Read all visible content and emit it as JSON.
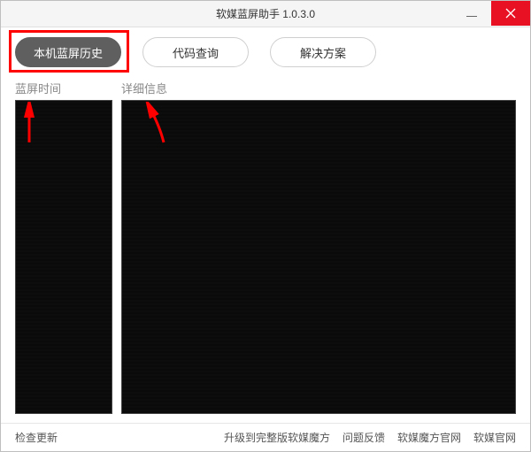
{
  "window": {
    "title": "软媒蓝屏助手 1.0.3.0"
  },
  "tabs": {
    "history": "本机蓝屏历史",
    "code_lookup": "代码查询",
    "solution": "解决方案"
  },
  "headers": {
    "time": "蓝屏时间",
    "detail": "详细信息"
  },
  "footer": {
    "check_update": "检查更新",
    "upgrade_full": "升级到完整版软媒魔方",
    "feedback": "问题反馈",
    "mofang_site": "软媒魔方官网",
    "ruanmei_site": "软媒官网"
  },
  "colors": {
    "accent_red": "#ff0000",
    "close_red": "#e81123",
    "tab_active_bg": "#5f5f5f"
  }
}
